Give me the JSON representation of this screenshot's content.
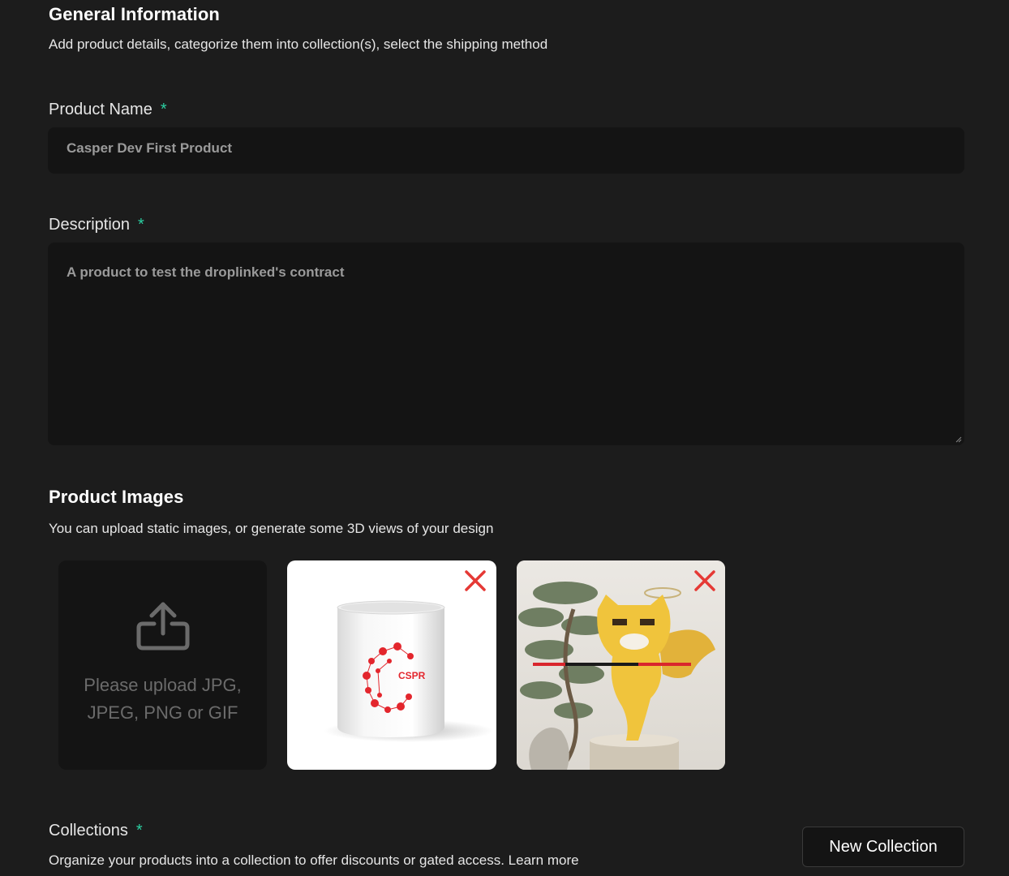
{
  "general": {
    "title": "General Information",
    "subtitle": "Add product details, categorize them into collection(s), select the shipping method"
  },
  "product_name": {
    "label": "Product Name",
    "required_mark": "*",
    "value": "Casper Dev First Product"
  },
  "description": {
    "label": "Description",
    "required_mark": "*",
    "value": "A product to test the droplinked's contract"
  },
  "images": {
    "title": "Product Images",
    "subtitle": "You can upload static images, or generate some 3D views of your design",
    "upload_text": "Please upload JPG, JPEG, PNG or GIF",
    "items": [
      {
        "name": "mug-image",
        "logo_text": "CSPR"
      },
      {
        "name": "tiger-image"
      }
    ]
  },
  "collections": {
    "label": "Collections",
    "required_mark": "*",
    "subtitle": "Organize your products into a collection to offer discounts or gated access. Learn more",
    "new_button": "New Collection"
  },
  "colors": {
    "background": "#1c1c1c",
    "input_bg": "#141414",
    "accent_required": "#2bcfa1",
    "remove_red": "#e53935",
    "brand_red": "#e3262d"
  }
}
